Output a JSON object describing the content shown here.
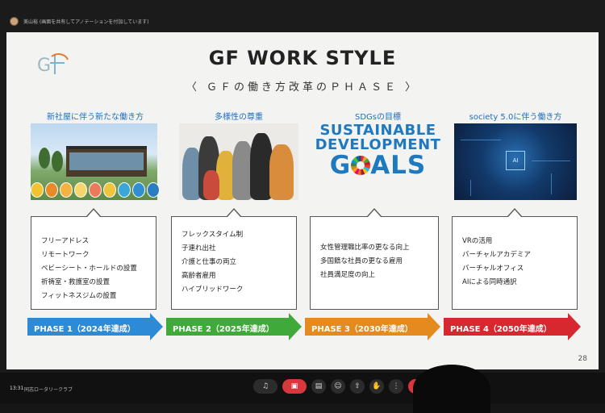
{
  "meeting": {
    "presenter_caption": "美山裕 (画面を共有してアノテーションを付加しています)",
    "time": "13:31",
    "meeting_name": "同志ロータリークラブ"
  },
  "slide": {
    "title": "GF WORK  STYLE",
    "subtitle": "〈 ＧＦの働き方改革のＰＨＡＳＥ 〉",
    "page_number": "28",
    "columns": [
      {
        "heading": "新社屋に伴う新たな働き方",
        "items": [
          "フリーアドレス",
          "リモートワーク",
          "ベビーシート・ホールドの設置",
          "祈祷室・救護室の設置",
          "フィットネスジムの設置"
        ],
        "phase_label": "PHASE 1（2024年達成）",
        "phase_color": "#2d8ad6"
      },
      {
        "heading": "多様性の尊重",
        "items": [
          "フレックスタイム制",
          "子連れ出社",
          "介護と仕事の両立",
          "高齢者雇用",
          "ハイブリッドワーク"
        ],
        "phase_label": "PHASE 2（2025年達成）",
        "phase_color": "#3faa3a"
      },
      {
        "heading": "SDGsの目標",
        "items": [
          "女性管理職比率の更なる向上",
          "多国籍な社員の更なる雇用",
          "社員満足度の向上"
        ],
        "phase_label": "PHASE 3（2030年達成）",
        "phase_color": "#e58a1f"
      },
      {
        "heading": "society 5.0に伴う働き方",
        "items": [
          "VRの活用",
          "バーチャルアカデミア",
          "バーチャルオフィス",
          "AIによる同時通訳"
        ],
        "phase_label": "PHASE 4（2050年達成）",
        "phase_color": "#d7282f"
      }
    ],
    "sdg_logo": {
      "line1": "SUSTAINABLE",
      "line2": "DEVELOPMENT",
      "line3_pre": "G",
      "line3_post": "ALS"
    },
    "ai_chip_label": "AI"
  },
  "icons": [
    "presenter-avatar-icon",
    "gf-logo-icon",
    "mic-icon",
    "camera-icon",
    "share-icon",
    "emoji-icon",
    "hand-icon",
    "more-icon",
    "end-call-icon"
  ]
}
